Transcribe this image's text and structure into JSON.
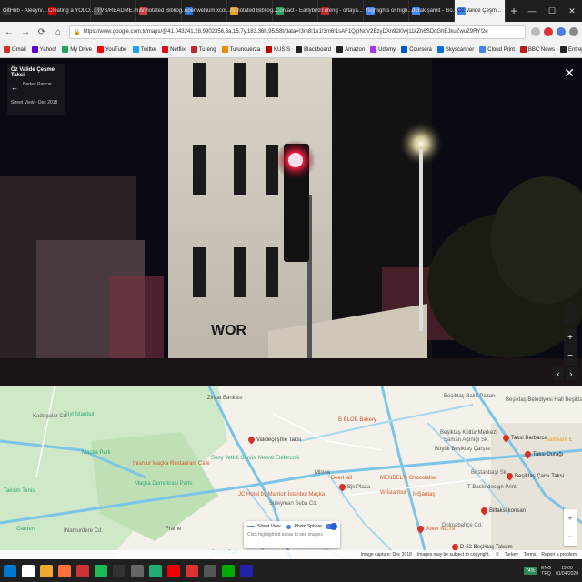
{
  "browser": {
    "tabs": [
      {
        "label": "GitHub - Aleeyn/...",
        "color": "#333333"
      },
      {
        "label": "Creating a YOLO...",
        "color": "#cc0000"
      },
      {
        "label": "TTVS/README.m...",
        "color": "#555555"
      },
      {
        "label": "Annotated Bibliog...",
        "color": "#d04040"
      },
      {
        "label": "openwellium.xcol...",
        "color": "#2a6fd6"
      },
      {
        "label": "Annotated Bibliog...",
        "color": "#e0a020"
      },
      {
        "label": "Contact - Earlybird",
        "color": "#2a9d5a"
      },
      {
        "label": "Tureng - ortaya...",
        "color": "#c0282d"
      },
      {
        "label": "highlights or high...",
        "color": "#4285f4"
      },
      {
        "label": "durak şarnit - Go...",
        "color": "#4285f4"
      },
      {
        "label": "Öz Valide Çeşm...",
        "color": "#4285f4"
      }
    ],
    "new_tab": "+",
    "window_controls": [
      "—",
      "☐",
      "✕"
    ],
    "url": "https://www.google.com.tr/maps/@41.043241,28.9902356,3a,15.7y,183.36h,95.58t/data=!3m8!1e1!3m6!1sAF1QipNqV2EzyDXn92l0wj11kZh6SDdGhBJkuZwuZ9RY!2e",
    "nav": {
      "back": "←",
      "forward": "→",
      "reload": "⟳",
      "home": "⌂"
    },
    "bookmarks": [
      {
        "label": "Gmail",
        "color": "#d93025"
      },
      {
        "label": "Yahoo!",
        "color": "#6001d2"
      },
      {
        "label": "My Drive",
        "color": "#1fa463"
      },
      {
        "label": "YouTube",
        "color": "#ff0000"
      },
      {
        "label": "Twitter",
        "color": "#1da1f2"
      },
      {
        "label": "Netflix",
        "color": "#e50914"
      },
      {
        "label": "Tureng",
        "color": "#c0282d"
      },
      {
        "label": "Turuncuerza",
        "color": "#f28c00"
      },
      {
        "label": "KUSIS",
        "color": "#c00000"
      },
      {
        "label": "Blackboard",
        "color": "#222222"
      },
      {
        "label": "Amazon",
        "color": "#222222"
      },
      {
        "label": "Udemy",
        "color": "#a435f0"
      },
      {
        "label": "Coursera",
        "color": "#0056d2"
      },
      {
        "label": "Skyscanner",
        "color": "#0770e3"
      },
      {
        "label": "Cloud Print",
        "color": "#4285f4"
      },
      {
        "label": "BBC News",
        "color": "#bb1919"
      },
      {
        "label": "Entrepreneur",
        "color": "#222222"
      },
      {
        "label": "Economist",
        "color": "#e3120b"
      },
      {
        "label": "Dövlz",
        "color": "#2a6fd6"
      },
      {
        "label": "Codecademy",
        "color": "#1f4056"
      },
      {
        "label": "documentary",
        "color": "#222222"
      }
    ]
  },
  "streetview": {
    "place_title": "Öz Valide Çeşme Taksi",
    "author": "Berker Pancar",
    "date": "Street View - Dec 2018",
    "close": "✕",
    "sign_text": "WOR",
    "zoom_in": "+",
    "zoom_out": "−",
    "pan_left": "‹",
    "pan_right": "›"
  },
  "map": {
    "labels": [
      {
        "text": "Toyl İstanbul",
        "color": "#3a7"
      },
      {
        "text": "Maçka Park",
        "color": "#3a7"
      },
      {
        "text": "Maçka Demokrasi Parkı",
        "color": "#3a7"
      },
      {
        "text": "Ihlamur Maçka Restaurant Cafe",
        "color": "#d35a2a"
      },
      {
        "text": "Taksim Tenis",
        "color": "#3a7"
      },
      {
        "text": "Ziraat Bankası",
        "color": "#555"
      },
      {
        "text": "Valideçeşme Taksi",
        "color": "#333"
      },
      {
        "text": "Sony Yetkili Servisi Melvel Elektronik",
        "color": "#3a7"
      },
      {
        "text": "JC Hotel by Marriott İstanbul Maçka",
        "color": "#d35a2a"
      },
      {
        "text": "B BLOK Bakery",
        "color": "#d35a2a"
      },
      {
        "text": "Mirroa",
        "color": "#555"
      },
      {
        "text": "BeerHall",
        "color": "#d35a2a"
      },
      {
        "text": "Bjk Plaza",
        "color": "#555"
      },
      {
        "text": "W İstanbul",
        "color": "#d35a2a"
      },
      {
        "text": "MENDEL'S Chocolatier",
        "color": "#d35a2a"
      },
      {
        "text": "NiŞantaş",
        "color": "#d35a2a"
      },
      {
        "text": "T-Baskı design Print",
        "color": "#555"
      },
      {
        "text": "Beşiktaş Kültür Merkezi",
        "color": "#555"
      },
      {
        "text": "Büyük Beşiktaş Çarşısı",
        "color": "#555"
      },
      {
        "text": "Beşiktaş Balık Pazarı",
        "color": "#555"
      },
      {
        "text": "Beşiktaş Belediyesi Hall Beşiktaş",
        "color": "#555"
      },
      {
        "text": "Taksi Barbaros",
        "color": "#333"
      },
      {
        "text": "Taksi Durağı",
        "color": "#333"
      },
      {
        "text": "Beşiktaş Çarşı Taksi",
        "color": "#333"
      },
      {
        "text": "Biltaksi konsan",
        "color": "#333"
      },
      {
        "text": "D-52 Beşiktaş Taksim",
        "color": "#333"
      },
      {
        "text": "Joker No:79",
        "color": "#d35a2a"
      },
      {
        "text": "Süleyman Seba Cd.",
        "color": "#666"
      },
      {
        "text": "Frame",
        "color": "#555"
      },
      {
        "text": "Garden",
        "color": "#3a7"
      },
      {
        "text": "Çocuk Park",
        "color": "#3a7"
      },
      {
        "text": "Zilioğlu Marketi Sahibi",
        "color": "#555"
      },
      {
        "text": "Samsara E",
        "color": "#e0a020"
      },
      {
        "text": "Şaman Ağırlığı Sk.",
        "color": "#666"
      },
      {
        "text": "Bostanbaşı Sk.",
        "color": "#666"
      },
      {
        "text": "Ihlamurdere Cd.",
        "color": "#666"
      },
      {
        "text": "Kadırgalar Cd.",
        "color": "#666"
      },
      {
        "text": "Dolmabahçe Cd.",
        "color": "#666"
      }
    ],
    "streetview_card": {
      "street_view": "Street View",
      "photo_sphere": "Photo Sphere",
      "hint": "Click highlighted areas to see images"
    },
    "zoom_in": "+",
    "zoom_out": "−",
    "footer": [
      "Image capture: Dec 2018",
      "Images may be subject to copyright.",
      "©",
      "Turkey",
      "Terms",
      "Report a problem"
    ]
  },
  "taskbar": {
    "apps": [
      "#0078d4",
      "#ffffff",
      "#f0a830",
      "#ff7139",
      "#c33",
      "#1db954",
      "#333",
      "#666",
      "#2a7",
      "#e00",
      "#d33",
      "#555",
      "#0a0",
      "#22a"
    ],
    "battery": "74%",
    "lang_top": "ENG",
    "lang_bottom": "TRQ",
    "time": "19:00",
    "date": "01/04/2020"
  }
}
